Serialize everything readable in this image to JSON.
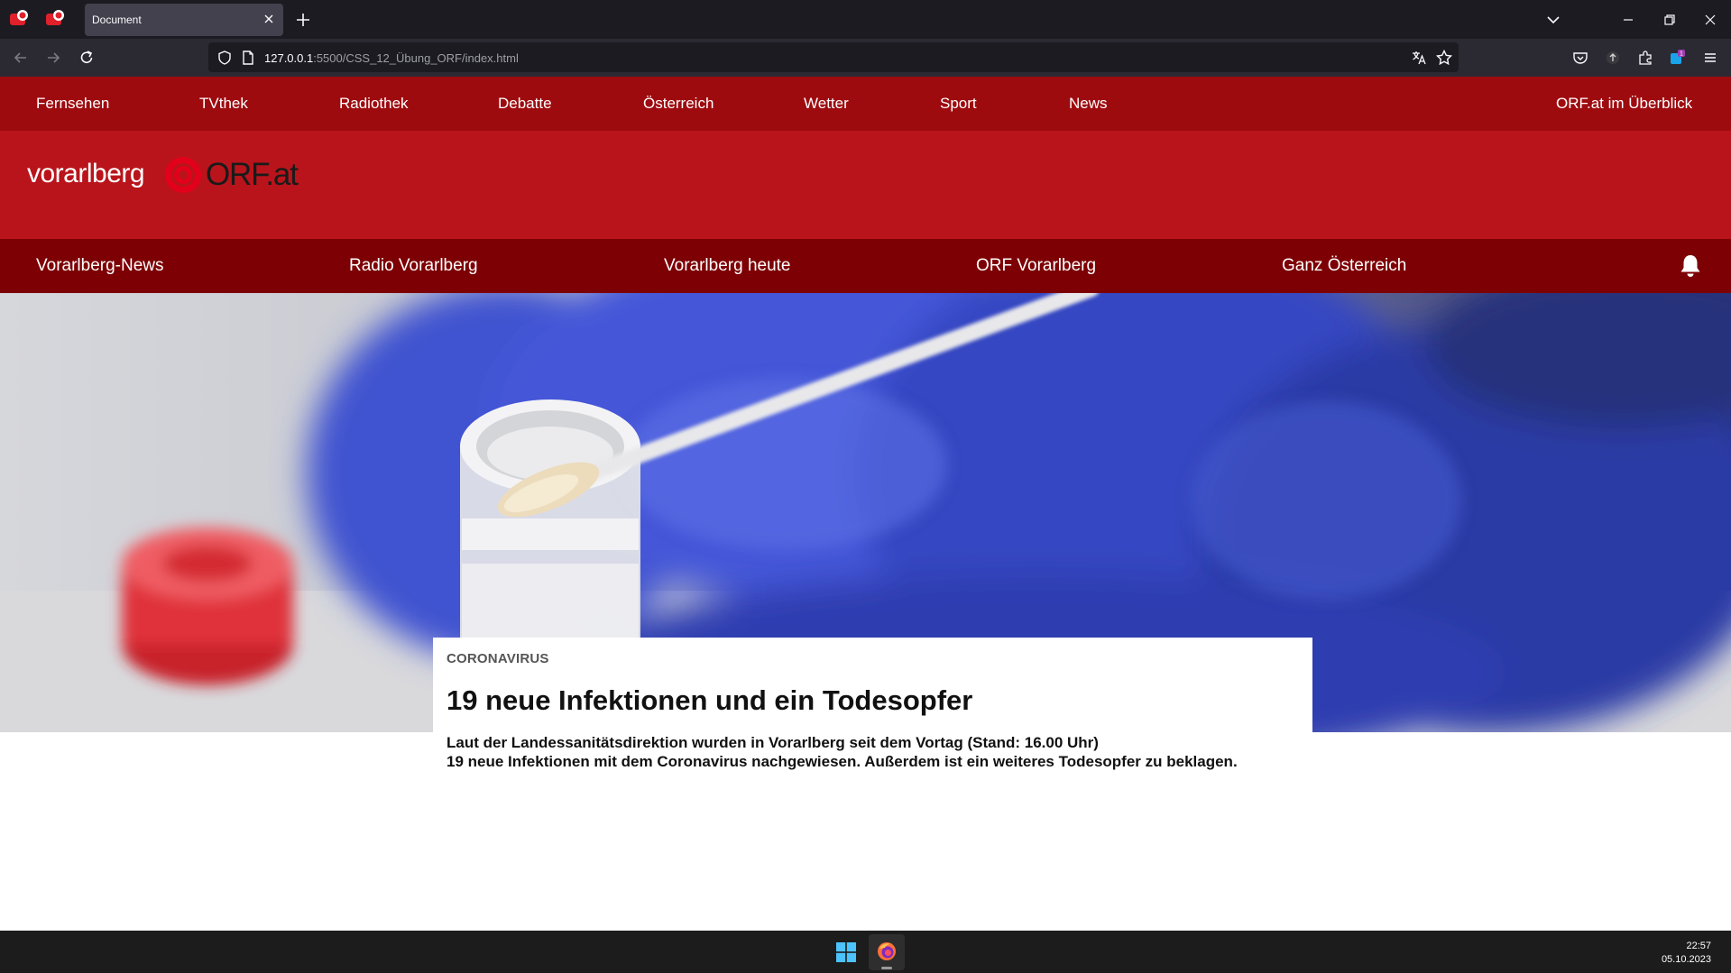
{
  "browser": {
    "tab_title": "Document",
    "url_host": "127.0.0.1",
    "url_path": ":5500/CSS_12_Übung_ORF/index.html"
  },
  "top_nav": {
    "items": [
      "Fernsehen",
      "TVthek",
      "Radiothek",
      "Debatte",
      "Österreich",
      "Wetter",
      "Sport",
      "News"
    ],
    "overview_link": "ORF.at im Überblick"
  },
  "brand": {
    "region": "vorarlberg",
    "site": "ORF.at"
  },
  "sub_nav": {
    "items": [
      "Vorarlberg-News",
      "Radio Vorarlberg",
      "Vorarlberg heute",
      "ORF Vorarlberg",
      "Ganz Österreich"
    ]
  },
  "article": {
    "kicker": "CORONAVIRUS",
    "title": "19 neue Infektionen und ein Todesopfer",
    "lead_line1": "Laut der Landessanitätsdirektion wurden in Vorarlberg seit dem Vortag (Stand: 16.00 Uhr)",
    "lead_line2": "19 neue Infektionen mit dem Coronavirus nachgewiesen. Außerdem ist ein weiteres Todesopfer zu beklagen."
  },
  "taskbar": {
    "time": "22:57",
    "date": "05.10.2023"
  },
  "colors": {
    "top_nav_bg": "#9e0b0f",
    "brand_bg": "#b9141b",
    "sub_nav_bg": "#7d0004",
    "orf_red": "#e2001a"
  }
}
